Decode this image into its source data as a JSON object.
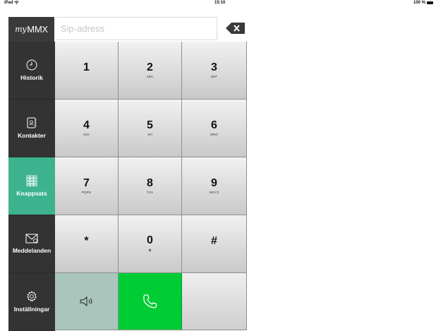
{
  "status_bar": {
    "device": "iPad",
    "time": "15:10",
    "battery": "100 %"
  },
  "app": {
    "logo_prefix": "my",
    "logo_main": "MMX"
  },
  "sip_field": {
    "placeholder": "Sip-adress",
    "value": ""
  },
  "sidebar": {
    "items": [
      {
        "label": "Historik",
        "icon": "clock-icon"
      },
      {
        "label": "Kontakter",
        "icon": "contacts-book-icon"
      },
      {
        "label": "Knappsats",
        "icon": "keypad-grid-icon",
        "active": true
      },
      {
        "label": "Meddelanden",
        "icon": "envelope-icon"
      },
      {
        "label": "Inställningar",
        "icon": "gear-icon"
      }
    ]
  },
  "keypad": {
    "keys": [
      {
        "digit": "1",
        "letters": ""
      },
      {
        "digit": "2",
        "letters": "ABC"
      },
      {
        "digit": "3",
        "letters": "DEF"
      },
      {
        "digit": "4",
        "letters": "GHI"
      },
      {
        "digit": "5",
        "letters": "JKl"
      },
      {
        "digit": "6",
        "letters": "MNO"
      },
      {
        "digit": "7",
        "letters": "PQRS"
      },
      {
        "digit": "8",
        "letters": "TUV"
      },
      {
        "digit": "9",
        "letters": "WXYZ"
      },
      {
        "digit": "*",
        "letters": ""
      },
      {
        "digit": "0",
        "letters": "+"
      },
      {
        "digit": "#",
        "letters": ""
      }
    ]
  },
  "colors": {
    "accent": "#3cb38e",
    "call": "#00cc33",
    "sidebar": "#333333",
    "speaker": "#a8c6bc"
  }
}
